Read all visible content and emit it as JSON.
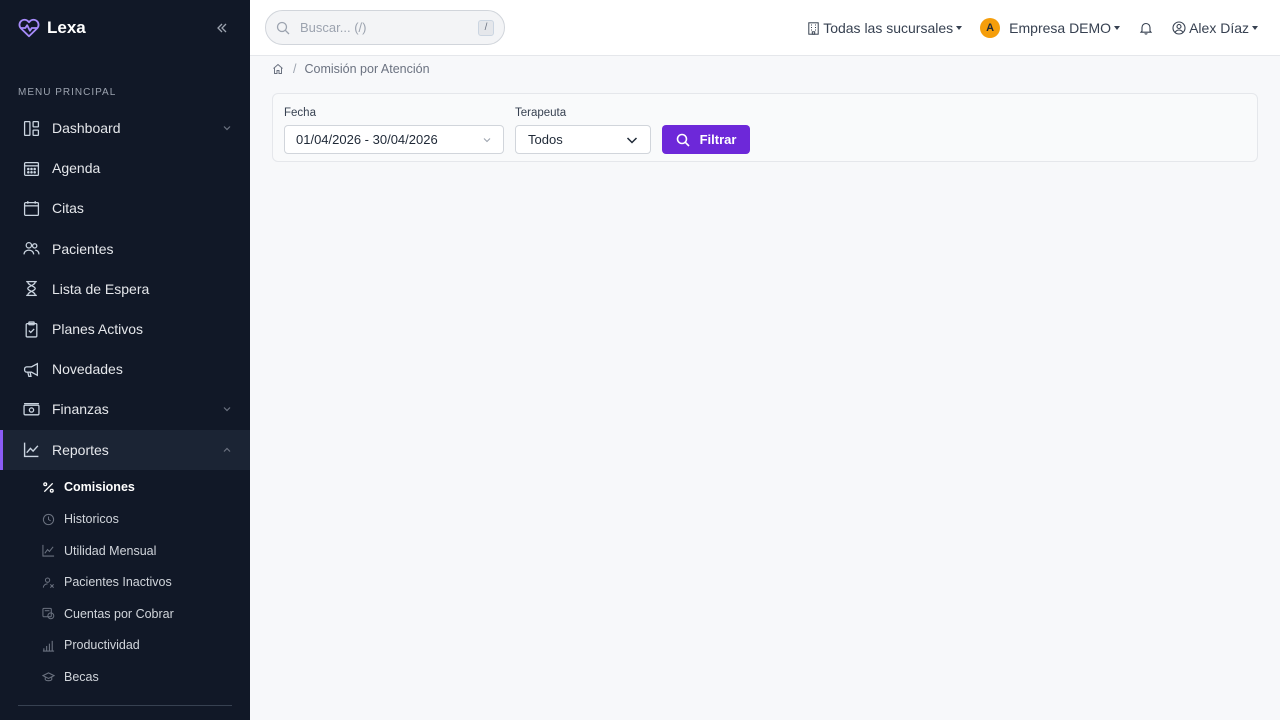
{
  "brand": {
    "name": "Lexa"
  },
  "sidebar": {
    "section_title": "MENU PRINCIPAL",
    "items": [
      {
        "label": "Dashboard",
        "icon": "dashboard-icon",
        "has_submenu": true
      },
      {
        "label": "Agenda",
        "icon": "calendar-grid-icon"
      },
      {
        "label": "Citas",
        "icon": "calendar-check-icon"
      },
      {
        "label": "Pacientes",
        "icon": "users-icon"
      },
      {
        "label": "Lista de Espera",
        "icon": "hourglass-icon"
      },
      {
        "label": "Planes Activos",
        "icon": "clipboard-check-icon"
      },
      {
        "label": "Novedades",
        "icon": "megaphone-icon"
      },
      {
        "label": "Finanzas",
        "icon": "cash-icon",
        "has_submenu": true
      },
      {
        "label": "Reportes",
        "icon": "line-chart-icon",
        "has_submenu": true,
        "expanded": true,
        "active": true
      }
    ],
    "reportes_submenu": [
      {
        "label": "Comisiones",
        "icon": "percent-icon",
        "active": true
      },
      {
        "label": "Historicos",
        "icon": "clock-history-icon"
      },
      {
        "label": "Utilidad Mensual",
        "icon": "graph-up-icon"
      },
      {
        "label": "Pacientes Inactivos",
        "icon": "person-x-icon"
      },
      {
        "label": "Cuentas por Cobrar",
        "icon": "receipt-icon"
      },
      {
        "label": "Productividad",
        "icon": "bar-chart-icon"
      },
      {
        "label": "Becas",
        "icon": "mortarboard-icon"
      }
    ]
  },
  "topbar": {
    "search_placeholder": "Buscar... (/)",
    "search_shortcut": "/",
    "branch_label": "Todas las sucursales",
    "company_initial": "A",
    "company_label": "Empresa DEMO",
    "user_label": "Alex Díaz"
  },
  "breadcrumb": {
    "current": "Comisión por Atención"
  },
  "filters": {
    "date_label": "Fecha",
    "date_value": "01/04/2026 - 30/04/2026",
    "therapist_label": "Terapeuta",
    "therapist_value": "Todos",
    "filter_button": "Filtrar"
  },
  "colors": {
    "sidebar_bg": "#111827",
    "accent": "#6d28d9",
    "company_avatar": "#f59e0b"
  }
}
